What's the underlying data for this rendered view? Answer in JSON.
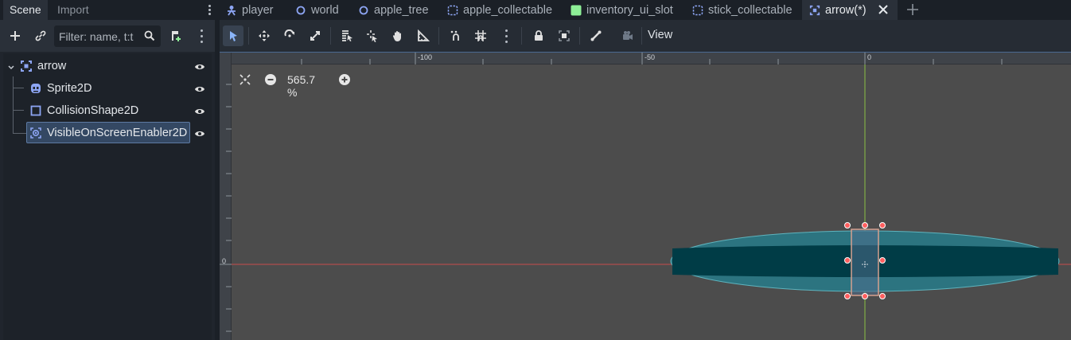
{
  "dock": {
    "tabs": [
      "Scene",
      "Import"
    ],
    "filter_placeholder": "Filter: name, t:t"
  },
  "tree": {
    "nodes": [
      {
        "label": "arrow",
        "icon": "node2d-icon"
      },
      {
        "label": "Sprite2D",
        "icon": "sprite-icon"
      },
      {
        "label": "CollisionShape2D",
        "icon": "collision-shape-icon"
      },
      {
        "label": "VisibleOnScreenEnabler2D",
        "icon": "visible-enabler-icon"
      }
    ]
  },
  "scene_tabs": [
    {
      "label": "player",
      "icon": "character-icon"
    },
    {
      "label": "world",
      "icon": "node-circle-icon"
    },
    {
      "label": "apple_tree",
      "icon": "node-circle-icon"
    },
    {
      "label": "apple_collectable",
      "icon": "area-icon"
    },
    {
      "label": "inventory_ui_slot",
      "icon": "control-icon"
    },
    {
      "label": "stick_collectable",
      "icon": "area-icon"
    },
    {
      "label": "arrow(*)",
      "icon": "node2d-icon"
    }
  ],
  "toolbar": {
    "view_label": "View"
  },
  "viewport": {
    "zoom": "565.7 %",
    "ruler_labels": [
      "-100",
      "-50",
      "0"
    ],
    "ruler_left_label": "0"
  },
  "colors": {
    "accent": "#5d7aa3",
    "node_blue": "#8da5f3",
    "control_green": "#8eef97",
    "shape_fill": "#2c7480",
    "shape_core": "#003c46",
    "handle": "#ff5f5f"
  }
}
